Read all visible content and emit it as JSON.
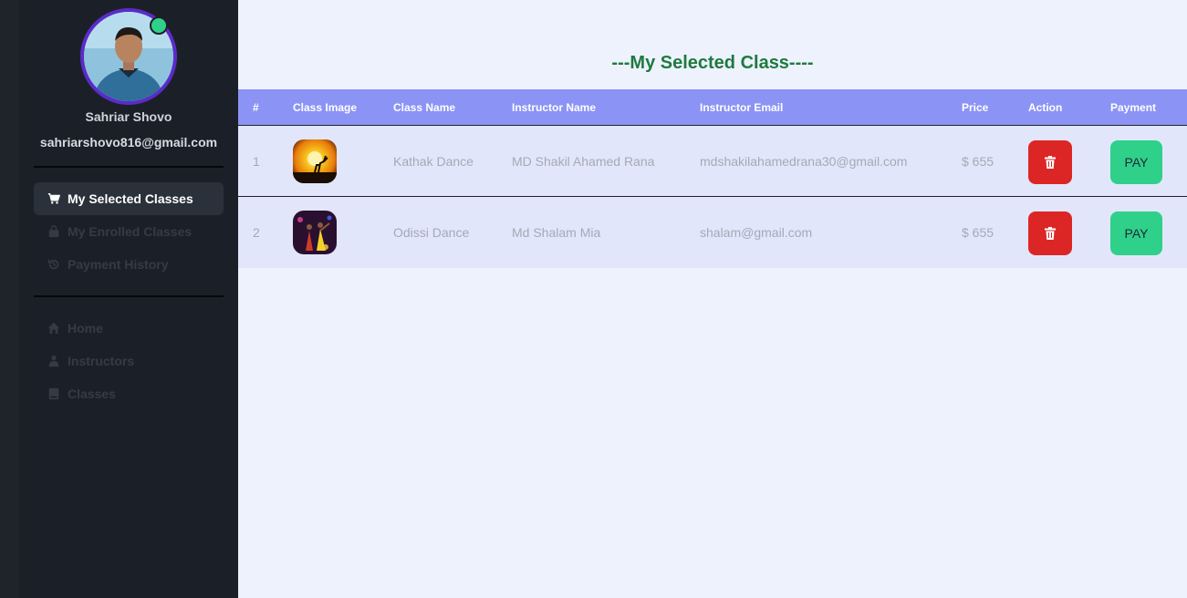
{
  "user": {
    "name": "Sahriar Shovo",
    "email": "sahriarshovo816@gmail.com"
  },
  "nav_primary": [
    {
      "label": "My Selected Classes",
      "icon": "cart-icon",
      "active": true
    },
    {
      "label": "My Enrolled Classes",
      "icon": "bag-icon",
      "active": false
    },
    {
      "label": "Payment History",
      "icon": "history-icon",
      "active": false
    }
  ],
  "nav_secondary": [
    {
      "label": "Home",
      "icon": "home-icon"
    },
    {
      "label": "Instructors",
      "icon": "instructor-icon"
    },
    {
      "label": "Classes",
      "icon": "book-icon"
    }
  ],
  "page": {
    "title": "---My Selected Class----"
  },
  "table": {
    "headers": [
      "#",
      "Class Image",
      "Class Name",
      "Instructor Name",
      "Instructor Email",
      "Price",
      "Action",
      "Payment"
    ],
    "rows": [
      {
        "num": "1",
        "class_name": "Kathak Dance",
        "instructor": "MD Shakil Ahamed Rana",
        "email": "mdshakilahamedrana30@gmail.com",
        "price": "$ 655",
        "pay_label": "PAY"
      },
      {
        "num": "2",
        "class_name": "Odissi Dance",
        "instructor": "Md Shalam Mia",
        "email": "shalam@gmail.com",
        "price": "$ 655",
        "pay_label": "PAY"
      }
    ]
  },
  "colors": {
    "header_bg": "#8b93f5",
    "row_bg": "#e2e6fb",
    "delete": "#dc2626",
    "pay": "#2fd08a",
    "title": "#1e7a3f",
    "sidebar": "#1b2028"
  }
}
